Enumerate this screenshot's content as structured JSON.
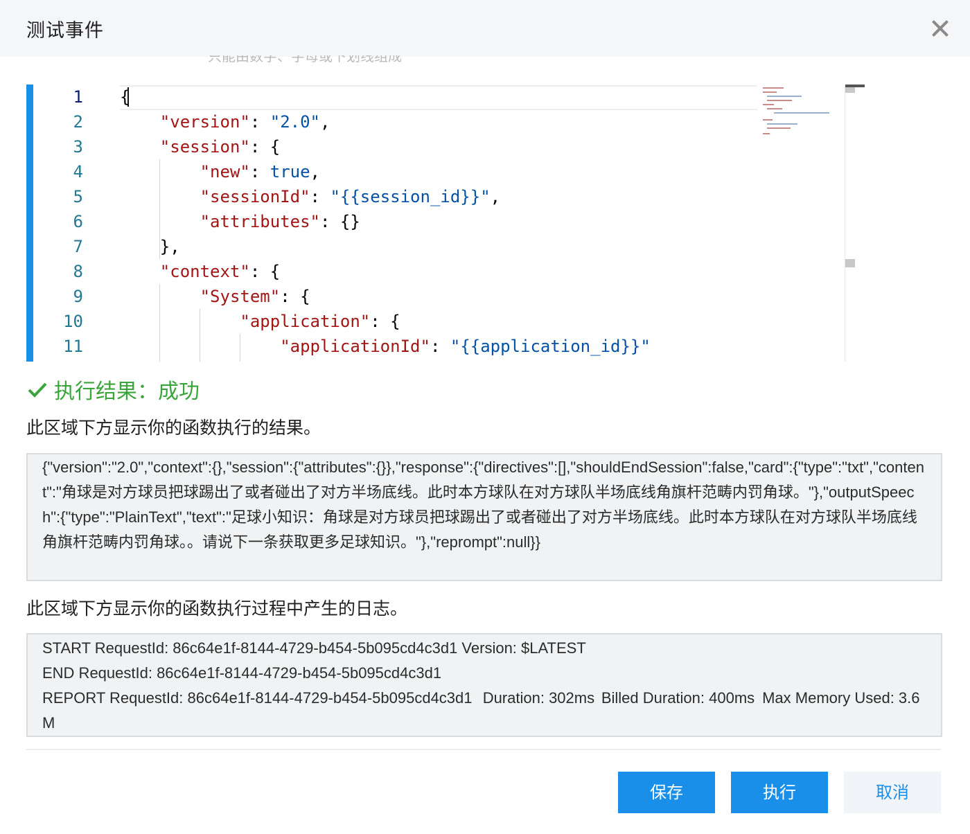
{
  "dialog": {
    "title": "测试事件",
    "cut_hint": "只能由数字、字母或下划线组成"
  },
  "editor": {
    "line_numbers": [
      "1",
      "2",
      "3",
      "4",
      "5",
      "6",
      "7",
      "8",
      "9",
      "10",
      "11"
    ],
    "lines": [
      "{",
      "    \"version\": \"2.0\",",
      "    \"session\": {",
      "        \"new\": true,",
      "        \"sessionId\": \"{{session_id}}\",",
      "        \"attributes\": {}",
      "    },",
      "    \"context\": {",
      "        \"System\": {",
      "            \"application\": {",
      "                \"applicationId\": \"{{application_id}}\""
    ]
  },
  "result": {
    "status_text": "执行结果：成功",
    "output_desc": "此区域下方显示你的函数执行的结果。",
    "output": "{\"version\":\"2.0\",\"context\":{},\"session\":{\"attributes\":{}},\"response\":{\"directives\":[],\"shouldEndSession\":false,\"card\":{\"type\":\"txt\",\"content\":\"角球是对方球员把球踢出了或者碰出了对方半场底线。此时本方球队在对方球队半场底线角旗杆范畴内罚角球。\"},\"outputSpeech\":{\"type\":\"PlainText\",\"text\":\"足球小知识：角球是对方球员把球踢出了或者碰出了对方半场底线。此时本方球队在对方球队半场底线角旗杆范畴内罚角球。。请说下一条获取更多足球知识。\"},\"reprompt\":null}}",
    "log_desc": "此区域下方显示你的函数执行过程中产生的日志。",
    "log": "START RequestId: 86c64e1f-8144-4729-b454-5b095cd4c3d1 Version: $LATEST\nEND RequestId: 86c64e1f-8144-4729-b454-5b095cd4c3d1\nREPORT RequestId: 86c64e1f-8144-4729-b454-5b095cd4c3d1\tDuration: 302ms\tBilled Duration: 400ms\tMax Memory Used: 3.6M"
  },
  "footer": {
    "save_label": "保存",
    "run_label": "执行",
    "cancel_label": "取消"
  },
  "colors": {
    "primary": "#1a8fe9",
    "success": "#3aa53b",
    "json_key": "#a31515",
    "json_string": "#0451a5"
  }
}
